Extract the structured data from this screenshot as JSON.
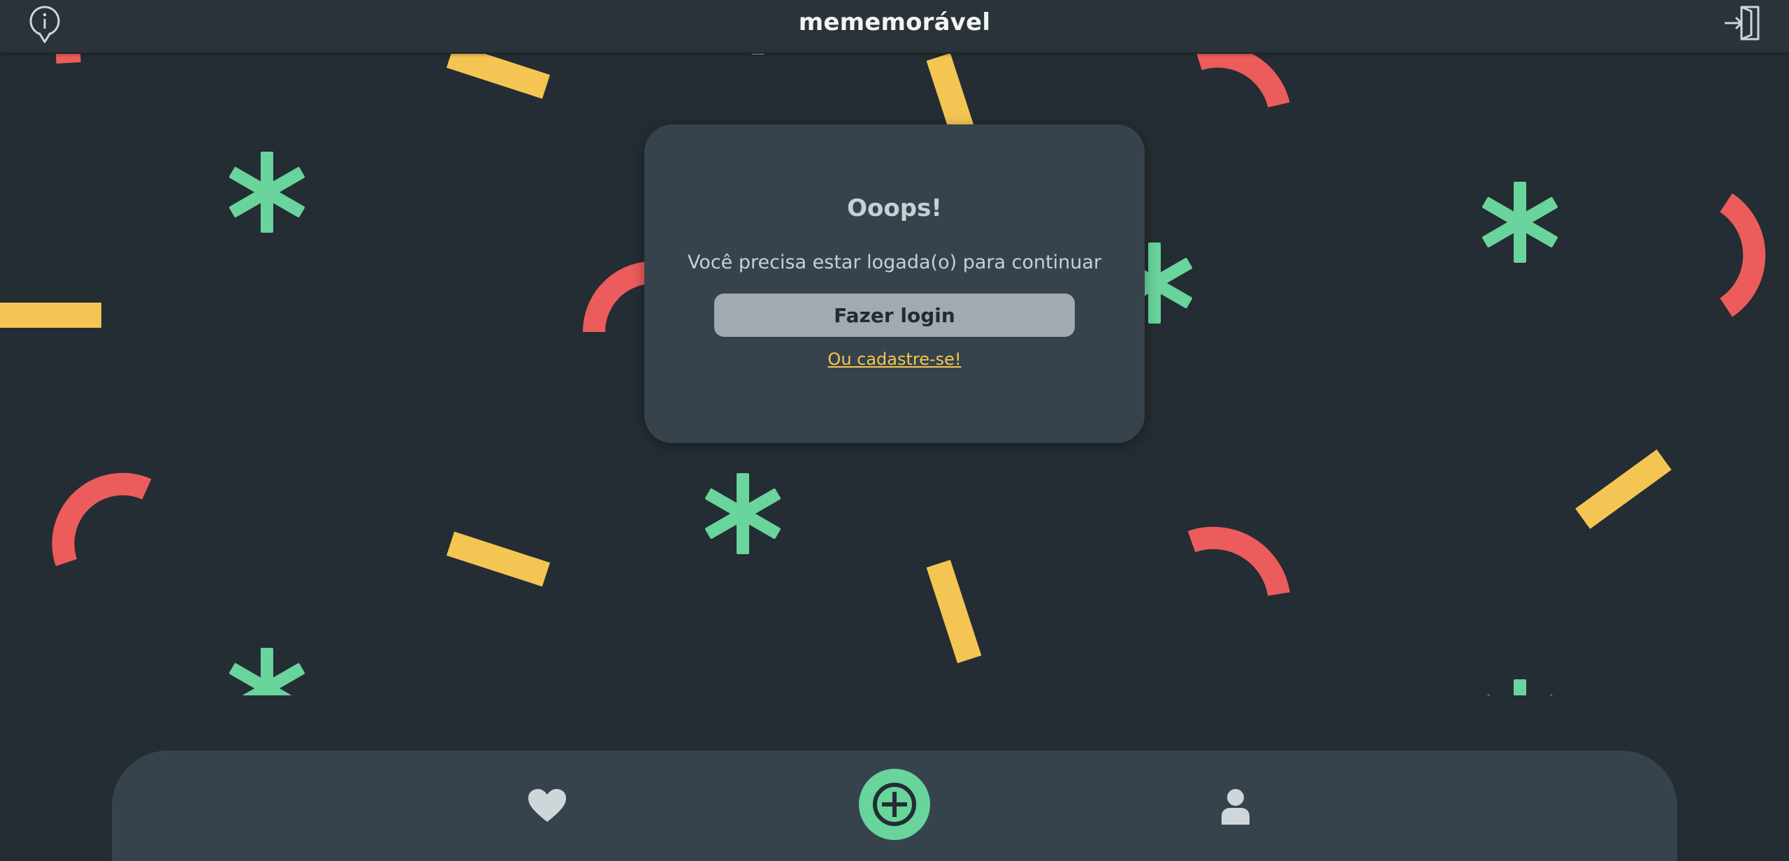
{
  "header": {
    "title": "mememorável",
    "info_icon": "info-icon",
    "login_icon": "login-icon"
  },
  "modal": {
    "title": "Ooops!",
    "message": "Você precisa estar logada(o) para continuar",
    "login_button_label": "Fazer login",
    "signup_link_label": "Ou cadastre-se!"
  },
  "bottom_nav": {
    "items": [
      {
        "icon": "heart-icon"
      },
      {
        "icon": "plus-icon"
      },
      {
        "icon": "user-icon"
      }
    ]
  },
  "colors": {
    "background": "#242d33",
    "header": "#2a333a",
    "card": "#36434c",
    "button": "#a1aab0",
    "accent_green": "#69d49b",
    "accent_yellow": "#f4c552",
    "accent_red": "#ec5c5c"
  }
}
